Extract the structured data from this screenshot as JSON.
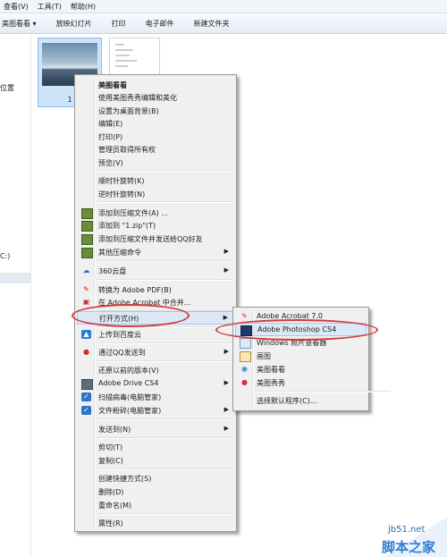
{
  "menubar": [
    "查看(V)",
    "工具(T)",
    "帮助(H)"
  ],
  "toolbar": [
    "美图看看  ▾",
    "放映幻灯片",
    "打印",
    "电子邮件",
    "新建文件夹"
  ],
  "nav": {
    "item1": "位置",
    "item2": "C:)"
  },
  "thumbnail": {
    "caption": "1"
  },
  "context_menu": {
    "items": [
      {
        "label": "美图看看"
      },
      {
        "label": "使用美图秀秀编辑和美化"
      },
      {
        "label": "设置为桌面背景(B)"
      },
      {
        "label": "编辑(E)"
      },
      {
        "label": "打印(P)"
      },
      {
        "label": "管理员取得所有权"
      },
      {
        "label": "预览(V)"
      },
      {
        "label": "顺时针旋转(K)"
      },
      {
        "label": "逆时针旋转(N)"
      },
      {
        "label": "添加到压缩文件(A) ..."
      },
      {
        "label": "添加到 \"1.zip\"(T)"
      },
      {
        "label": "添加到压缩文件并发送给QQ好友"
      },
      {
        "label": "其他压缩命令"
      },
      {
        "label": "360云盘"
      },
      {
        "label": "转换为 Adobe PDF(B)"
      },
      {
        "label": "在 Adobe Acrobat 中合并..."
      },
      {
        "label": "打开方式(H)"
      },
      {
        "label": "上传到百度云"
      },
      {
        "label": "通过QQ发送到"
      },
      {
        "label": "还原以前的版本(V)"
      },
      {
        "label": "Adobe Drive CS4"
      },
      {
        "label": "扫描病毒(电脑管家)"
      },
      {
        "label": "文件粉碎(电脑管家)"
      },
      {
        "label": "发送到(N)"
      },
      {
        "label": "剪切(T)"
      },
      {
        "label": "复制(C)"
      },
      {
        "label": "创建快捷方式(S)"
      },
      {
        "label": "删除(D)"
      },
      {
        "label": "重命名(M)"
      },
      {
        "label": "属性(R)"
      }
    ]
  },
  "submenu": {
    "items": [
      {
        "label": "Adobe Acrobat 7.0"
      },
      {
        "label": "Adobe Photoshop CS4"
      },
      {
        "label": "Windows 照片查看器"
      },
      {
        "label": "画图"
      },
      {
        "label": "美图看看"
      },
      {
        "label": "美图秀秀"
      },
      {
        "label": "选择默认程序(C)..."
      }
    ]
  },
  "watermark": {
    "site": "jb51.net",
    "brand": "脚本之家"
  },
  "colors": {
    "highlight_oval": "#d33a3a",
    "menu_bg": "#f0f0f0",
    "hover": "#dce8f6"
  }
}
